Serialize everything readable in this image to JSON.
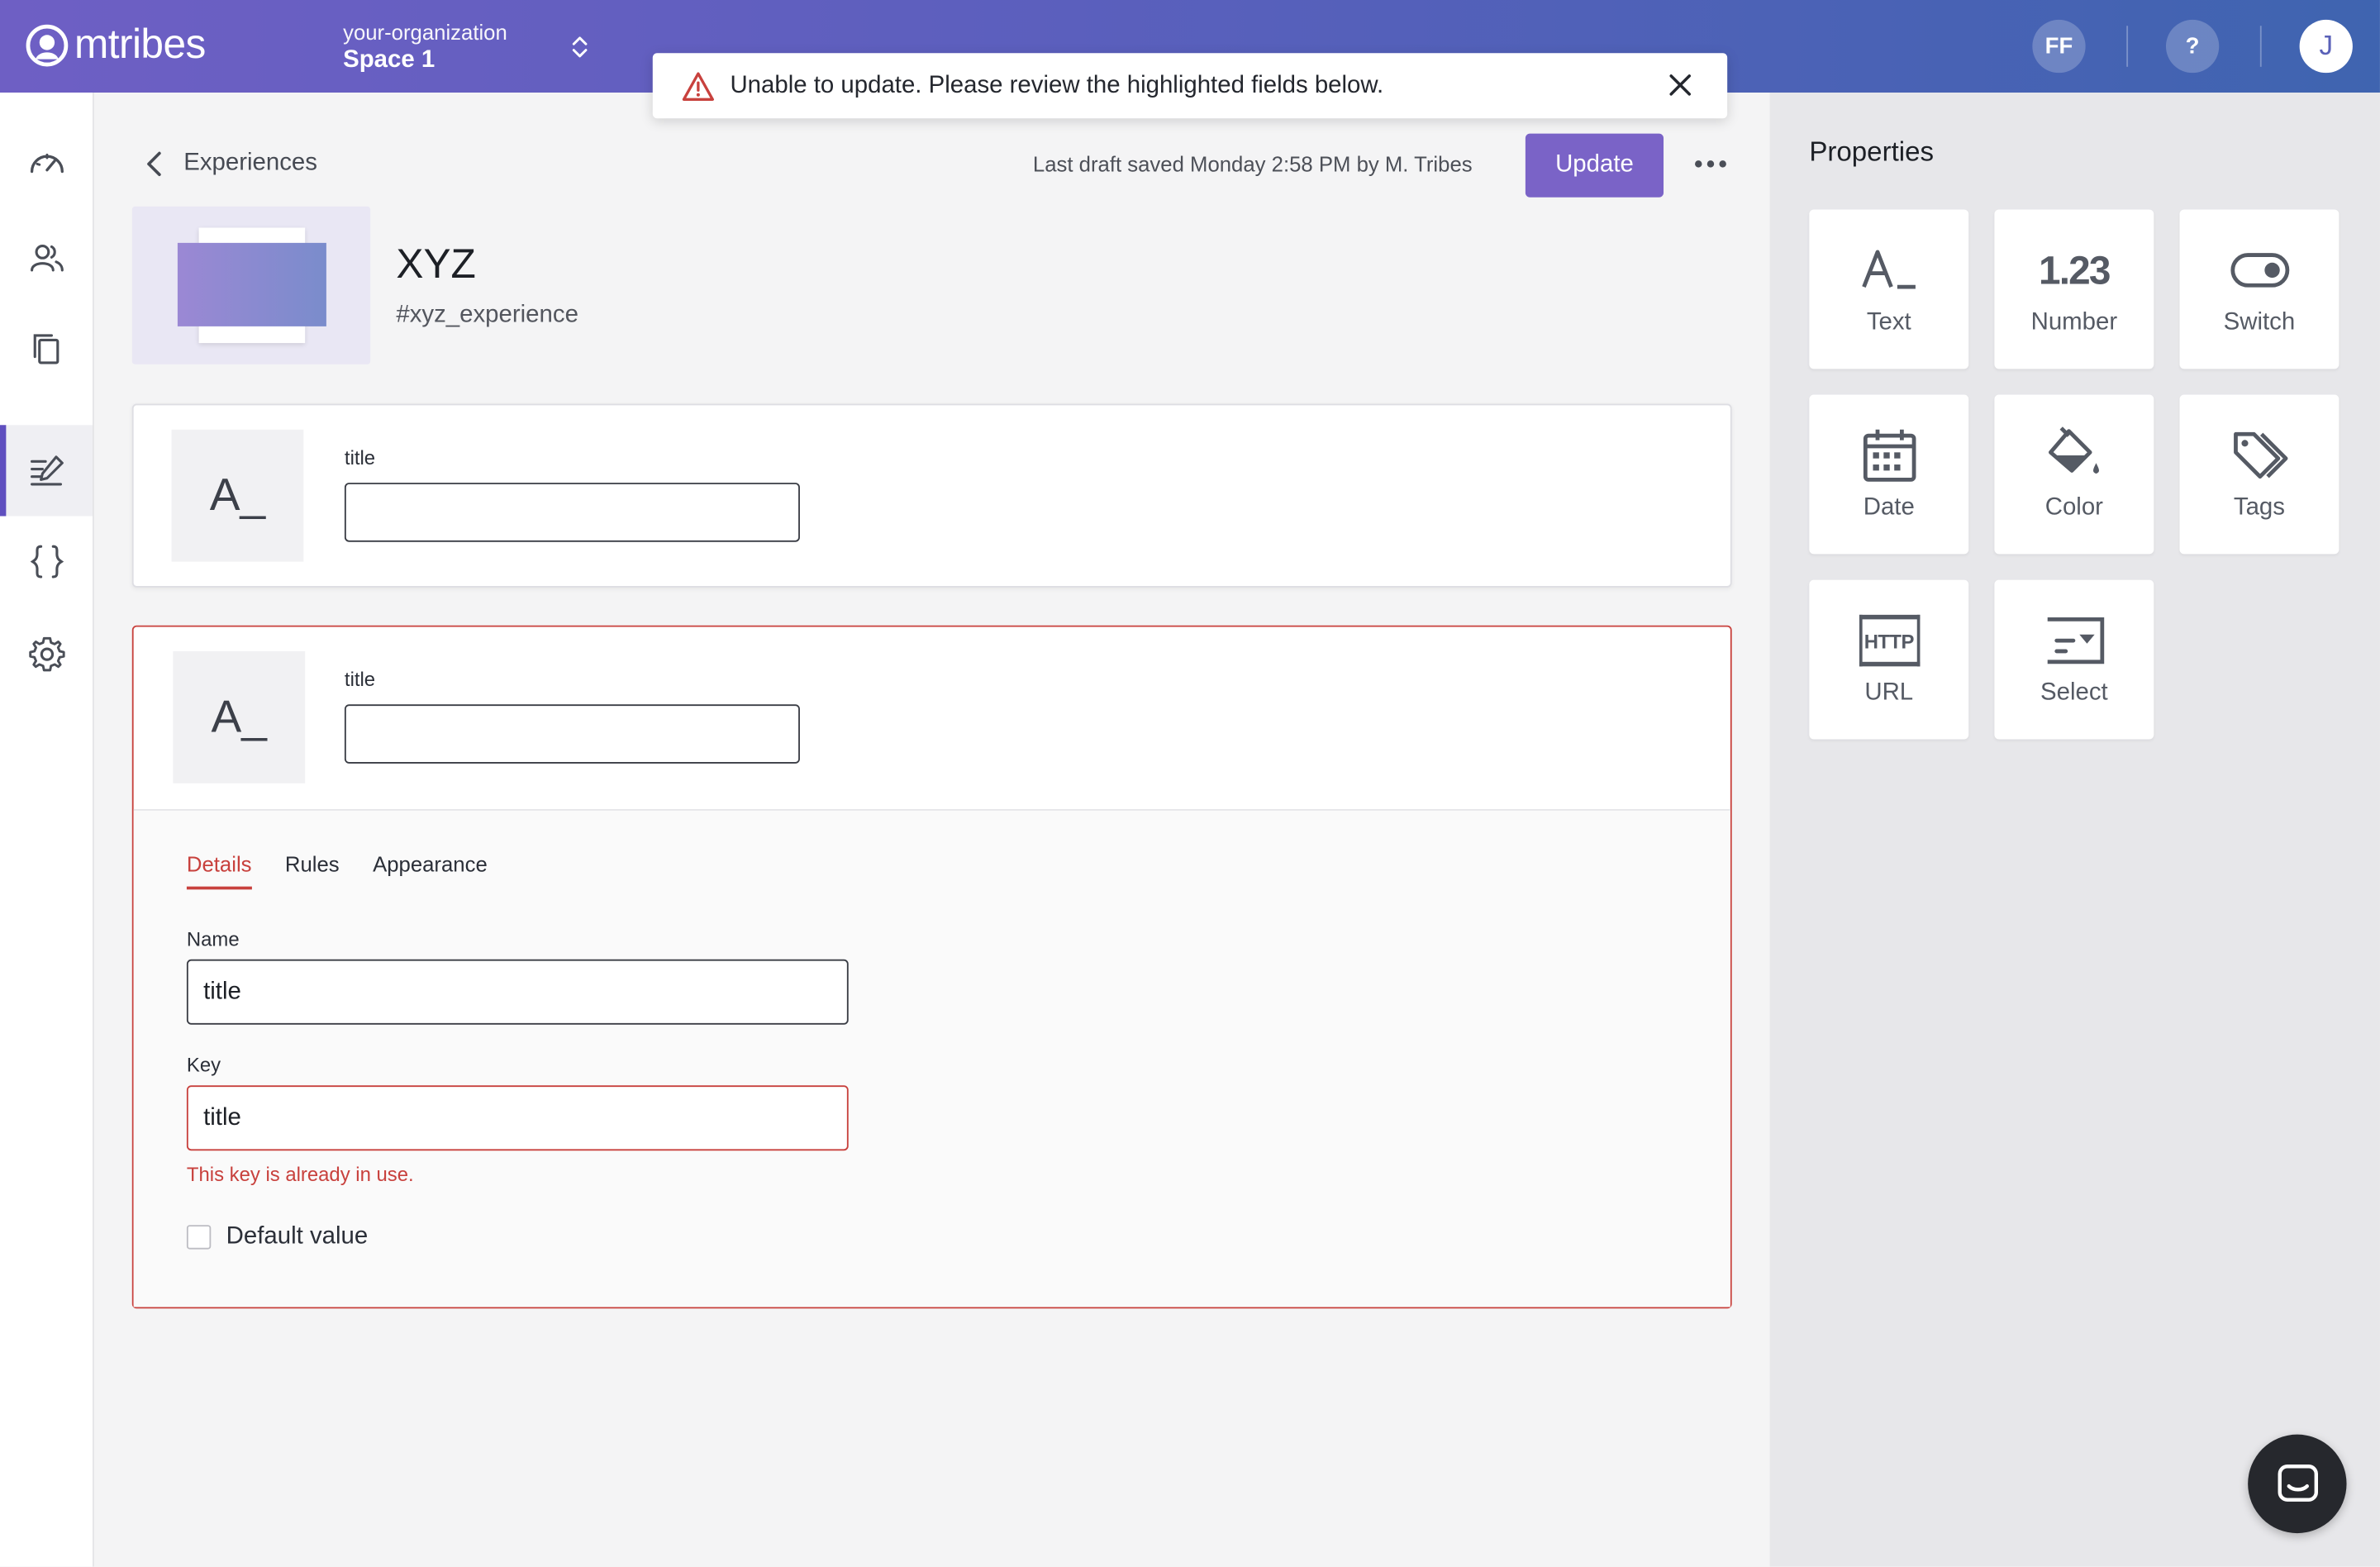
{
  "brand": {
    "name": "mtribes"
  },
  "header": {
    "org_name": "your-organization",
    "space_name": "Space 1",
    "user_initials": "FF",
    "help_label": "?",
    "avatar_initial": "J"
  },
  "alert": {
    "message": "Unable to update. Please review the highlighted fields below."
  },
  "sidebar": {
    "items": [
      {
        "icon": "dashboard-gauge-icon"
      },
      {
        "icon": "audiences-users-icon"
      },
      {
        "icon": "copy-collections-icon"
      },
      {
        "icon": "edit-experiences-icon",
        "active": true
      },
      {
        "icon": "code-braces-icon"
      },
      {
        "icon": "settings-gear-icon"
      }
    ]
  },
  "toolbar": {
    "back_label": "Experiences",
    "saved_text": "Last draft saved Monday 2:58 PM by M. Tribes",
    "update_label": "Update"
  },
  "experience": {
    "title": "XYZ",
    "key": "#xyz_experience"
  },
  "property_cards": [
    {
      "type_glyph": "A_",
      "field_label": "title",
      "value": ""
    },
    {
      "type_glyph": "A_",
      "field_label": "title",
      "value": "",
      "tabs": [
        "Details",
        "Rules",
        "Appearance"
      ],
      "active_tab": "Details",
      "name_label": "Name",
      "name_value": "title",
      "key_label": "Key",
      "key_value": "title",
      "key_error": "This key is already in use.",
      "default_label": "Default value"
    }
  ],
  "properties_panel": {
    "title": "Properties",
    "types": [
      {
        "label": "Text",
        "icon": "text-type-icon"
      },
      {
        "label": "Number",
        "icon": "number-type-icon",
        "glyph": "1.23"
      },
      {
        "label": "Switch",
        "icon": "switch-toggle-icon"
      },
      {
        "label": "Date",
        "icon": "calendar-icon"
      },
      {
        "label": "Color",
        "icon": "paint-bucket-icon"
      },
      {
        "label": "Tags",
        "icon": "tags-icon"
      },
      {
        "label": "URL",
        "icon": "http-url-icon",
        "glyph": "HTTP"
      },
      {
        "label": "Select",
        "icon": "select-dropdown-icon"
      }
    ]
  },
  "colors": {
    "accent": "#7a63c7",
    "error": "#c8413d"
  }
}
